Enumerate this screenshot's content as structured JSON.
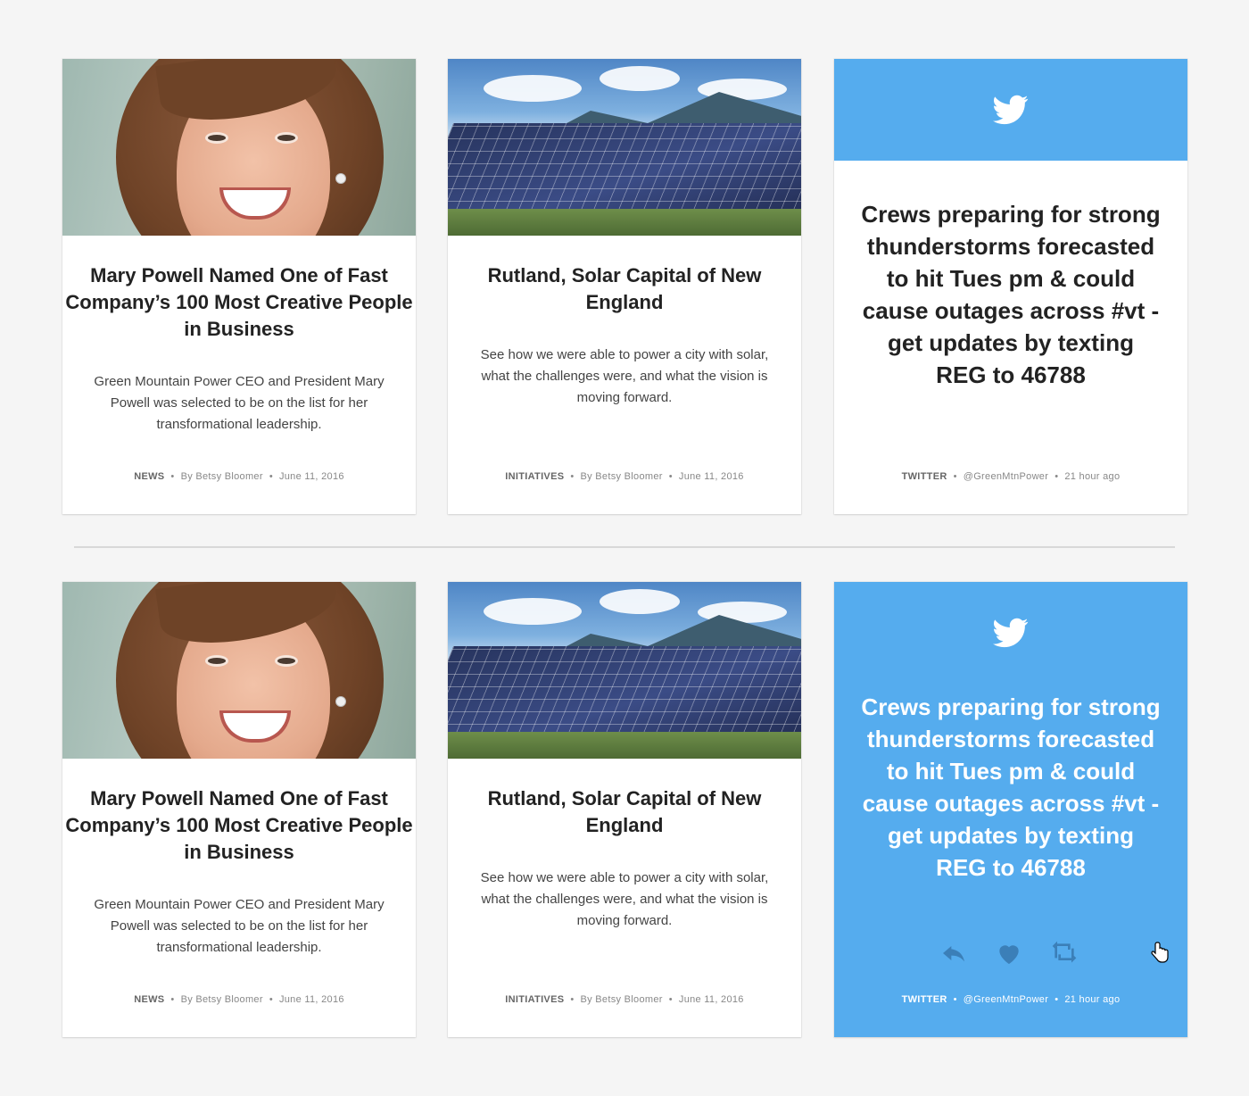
{
  "articles": [
    {
      "title": "Mary Powell Named One of Fast Company’s 100 Most Creative People in Business",
      "description": "Green Mountain Power CEO and President Mary Powell was selected to be on the list for her transformational leadership.",
      "category": "NEWS",
      "author": "By Betsy Bloomer",
      "date": "June 11, 2016",
      "image": "portrait-photo"
    },
    {
      "title": "Rutland, Solar Capital of New England",
      "description": "See how we were able to power a city with solar, what the challenges were, and what the vision is moving forward.",
      "category": "INITIATIVES",
      "author": "By Betsy Bloomer",
      "date": "June 11, 2016",
      "image": "solar-panels-photo"
    }
  ],
  "tweet": {
    "text": "Crews preparing for strong thunderstorms forecasted to hit Tues pm & could cause outages across #vt - get updates by texting REG to 46788",
    "category": "TWITTER",
    "handle": "@GreenMtnPower",
    "time": "21 hour ago",
    "icon": "twitter-bird-icon",
    "hover_actions": [
      "reply-icon",
      "like-icon",
      "retweet-icon"
    ]
  },
  "colors": {
    "twitter_blue": "#55acee",
    "background": "#f5f5f5",
    "card": "#ffffff",
    "action_icon": "#3b7fb8"
  }
}
